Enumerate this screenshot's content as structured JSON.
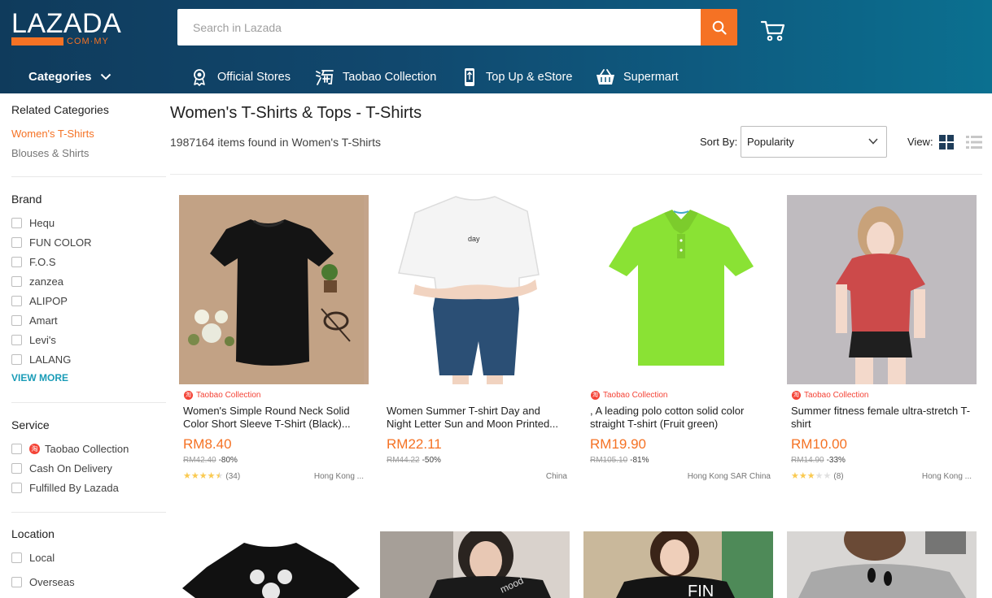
{
  "header": {
    "logo": "LAZADA",
    "logo_sub": "COM·MY",
    "search_placeholder": "Search in Lazada",
    "categories_label": "Categories",
    "nav": [
      {
        "label": "Official Stores",
        "icon": "badge-icon"
      },
      {
        "label": "Taobao Collection",
        "icon": "taobao-icon"
      },
      {
        "label": "Top Up & eStore",
        "icon": "phone-icon"
      },
      {
        "label": "Supermart",
        "icon": "basket-icon"
      }
    ]
  },
  "sidebar": {
    "related_title": "Related Categories",
    "related": [
      "Women's T-Shirts",
      "Blouses & Shirts"
    ],
    "brand_title": "Brand",
    "brands": [
      "Hequ",
      "FUN COLOR",
      "F.O.S",
      "zanzea",
      "ALIPOP",
      "Amart",
      "Levi's",
      "LALANG"
    ],
    "view_more": "VIEW MORE",
    "service_title": "Service",
    "services": [
      "Taobao Collection",
      "Cash On Delivery",
      "Fulfilled By Lazada"
    ],
    "location_title": "Location",
    "locations": [
      "Local",
      "Overseas"
    ]
  },
  "main": {
    "title": "Women's T-Shirts & Tops - T-Shirts",
    "items_found": "1987164 items found in Women's T-Shirts",
    "sort_label": "Sort By:",
    "sort_value": "Popularity",
    "view_label": "View:"
  },
  "products": [
    {
      "taobao": "Taobao Collection",
      "name": "Women's Simple Round Neck Solid Color Short Sleeve T-Shirt (Black)...",
      "price": "RM8.40",
      "orig": "RM42.40",
      "disc": "-80%",
      "rating": 4.5,
      "reviews": "(34)",
      "location": "Hong Kong ..."
    },
    {
      "taobao": "",
      "name": "Women Summer T-shirt Day and Night Letter Sun and Moon Printed...",
      "price": "RM22.11",
      "orig": "RM44.22",
      "disc": "-50%",
      "rating": 0,
      "reviews": "",
      "location": "China"
    },
    {
      "taobao": "Taobao Collection",
      "name": ", A leading polo cotton solid color straight T-shirt (Fruit green)",
      "price": "RM19.90",
      "orig": "RM105.10",
      "disc": "-81%",
      "rating": 0,
      "reviews": "",
      "location": "Hong Kong SAR China"
    },
    {
      "taobao": "Taobao Collection",
      "name": "Summer fitness female ultra-stretch T-shirt",
      "price": "RM10.00",
      "orig": "RM14.90",
      "disc": "-33%",
      "rating": 3,
      "reviews": "(8)",
      "location": "Hong Kong ..."
    }
  ]
}
